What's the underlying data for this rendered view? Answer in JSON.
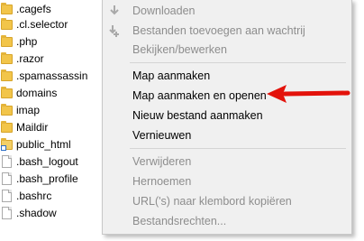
{
  "files": [
    {
      "name": ".cagefs",
      "type": "folder"
    },
    {
      "name": ".cl.selector",
      "type": "folder"
    },
    {
      "name": ".php",
      "type": "folder"
    },
    {
      "name": ".razor",
      "type": "folder"
    },
    {
      "name": ".spamassassin",
      "type": "folder"
    },
    {
      "name": "domains",
      "type": "folder"
    },
    {
      "name": "imap",
      "type": "folder"
    },
    {
      "name": "Maildir",
      "type": "folder"
    },
    {
      "name": "public_html",
      "type": "folder-link"
    },
    {
      "name": ".bash_logout",
      "type": "file"
    },
    {
      "name": ".bash_profile",
      "type": "file"
    },
    {
      "name": ".bashrc",
      "type": "file"
    },
    {
      "name": ".shadow",
      "type": "file"
    }
  ],
  "menu": {
    "download": {
      "label": "Downloaden",
      "icon": "download-arrow-icon"
    },
    "add_queue": {
      "label": "Bestanden toevoegen aan wachtrij",
      "icon": "add-to-queue-icon"
    },
    "view_edit": {
      "label": "Bekijken/bewerken"
    },
    "create_dir": {
      "label": "Map aanmaken"
    },
    "create_dir_enter": {
      "label": "Map aanmaken en openen"
    },
    "new_file": {
      "label": "Nieuw bestand aanmaken"
    },
    "refresh": {
      "label": "Vernieuwen"
    },
    "delete": {
      "label": "Verwijderen"
    },
    "rename": {
      "label": "Hernoemen"
    },
    "copy_url": {
      "label": "URL('s) naar klembord kopiëren"
    },
    "permissions": {
      "label": "Bestandsrechten..."
    }
  },
  "colors": {
    "menu_bg": "#f0f0f0",
    "disabled_text": "#8d8d8d",
    "annotation_arrow": "#e3120b",
    "folder": "#f2c54a"
  }
}
